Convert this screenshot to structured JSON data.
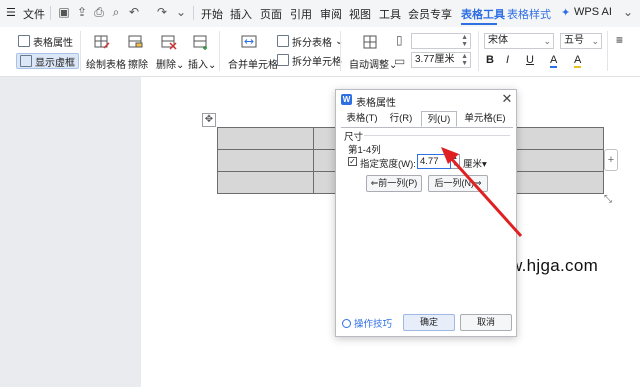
{
  "menubar": {
    "hamburger": "☰",
    "file": "文件",
    "tabs": [
      "开始",
      "插入",
      "页面",
      "引用",
      "审阅",
      "视图",
      "工具",
      "会员专享",
      "表格工具",
      "表格样式"
    ],
    "active_tab": "表格工具",
    "wps_ai": "WPS AI",
    "accent": "#2f6fe4"
  },
  "ribbon": {
    "table_props": "表格属性",
    "show_gridlines": "显示虚框",
    "draw_table": "绘制表格",
    "erase": "擦除",
    "delete": "删除",
    "insert": "插入",
    "merge_cells": "合并单元格",
    "split_table": "拆分表格",
    "split_cells": "拆分单元格",
    "auto_fit": "自动调整",
    "height_value": "",
    "width_value": "3.77厘米",
    "font_name": "宋体",
    "font_size": "五号",
    "bold": "B",
    "italic": "I",
    "underline": "U",
    "font_color": "A",
    "highlight": "A"
  },
  "document": {
    "watermark": "w.hjga.com",
    "table_rows": 3,
    "table_cols": 4
  },
  "dialog": {
    "logo": "W",
    "title": "表格属性",
    "tabs": [
      "表格(T)",
      "行(R)",
      "列(U)",
      "单元格(E)"
    ],
    "active_tab": "列(U)",
    "group": "尺寸",
    "columns_label": "第1-4列",
    "checkbox_checked": true,
    "checkbox_label": "指定宽度(W):",
    "width_value": "4.77",
    "unit": "厘米",
    "prev_column": "⇐前一列(P)",
    "next_column": "后一列(N)⇒",
    "tips": "操作技巧",
    "ok": "确定",
    "cancel": "取消"
  },
  "annotation_color": "#e02020"
}
